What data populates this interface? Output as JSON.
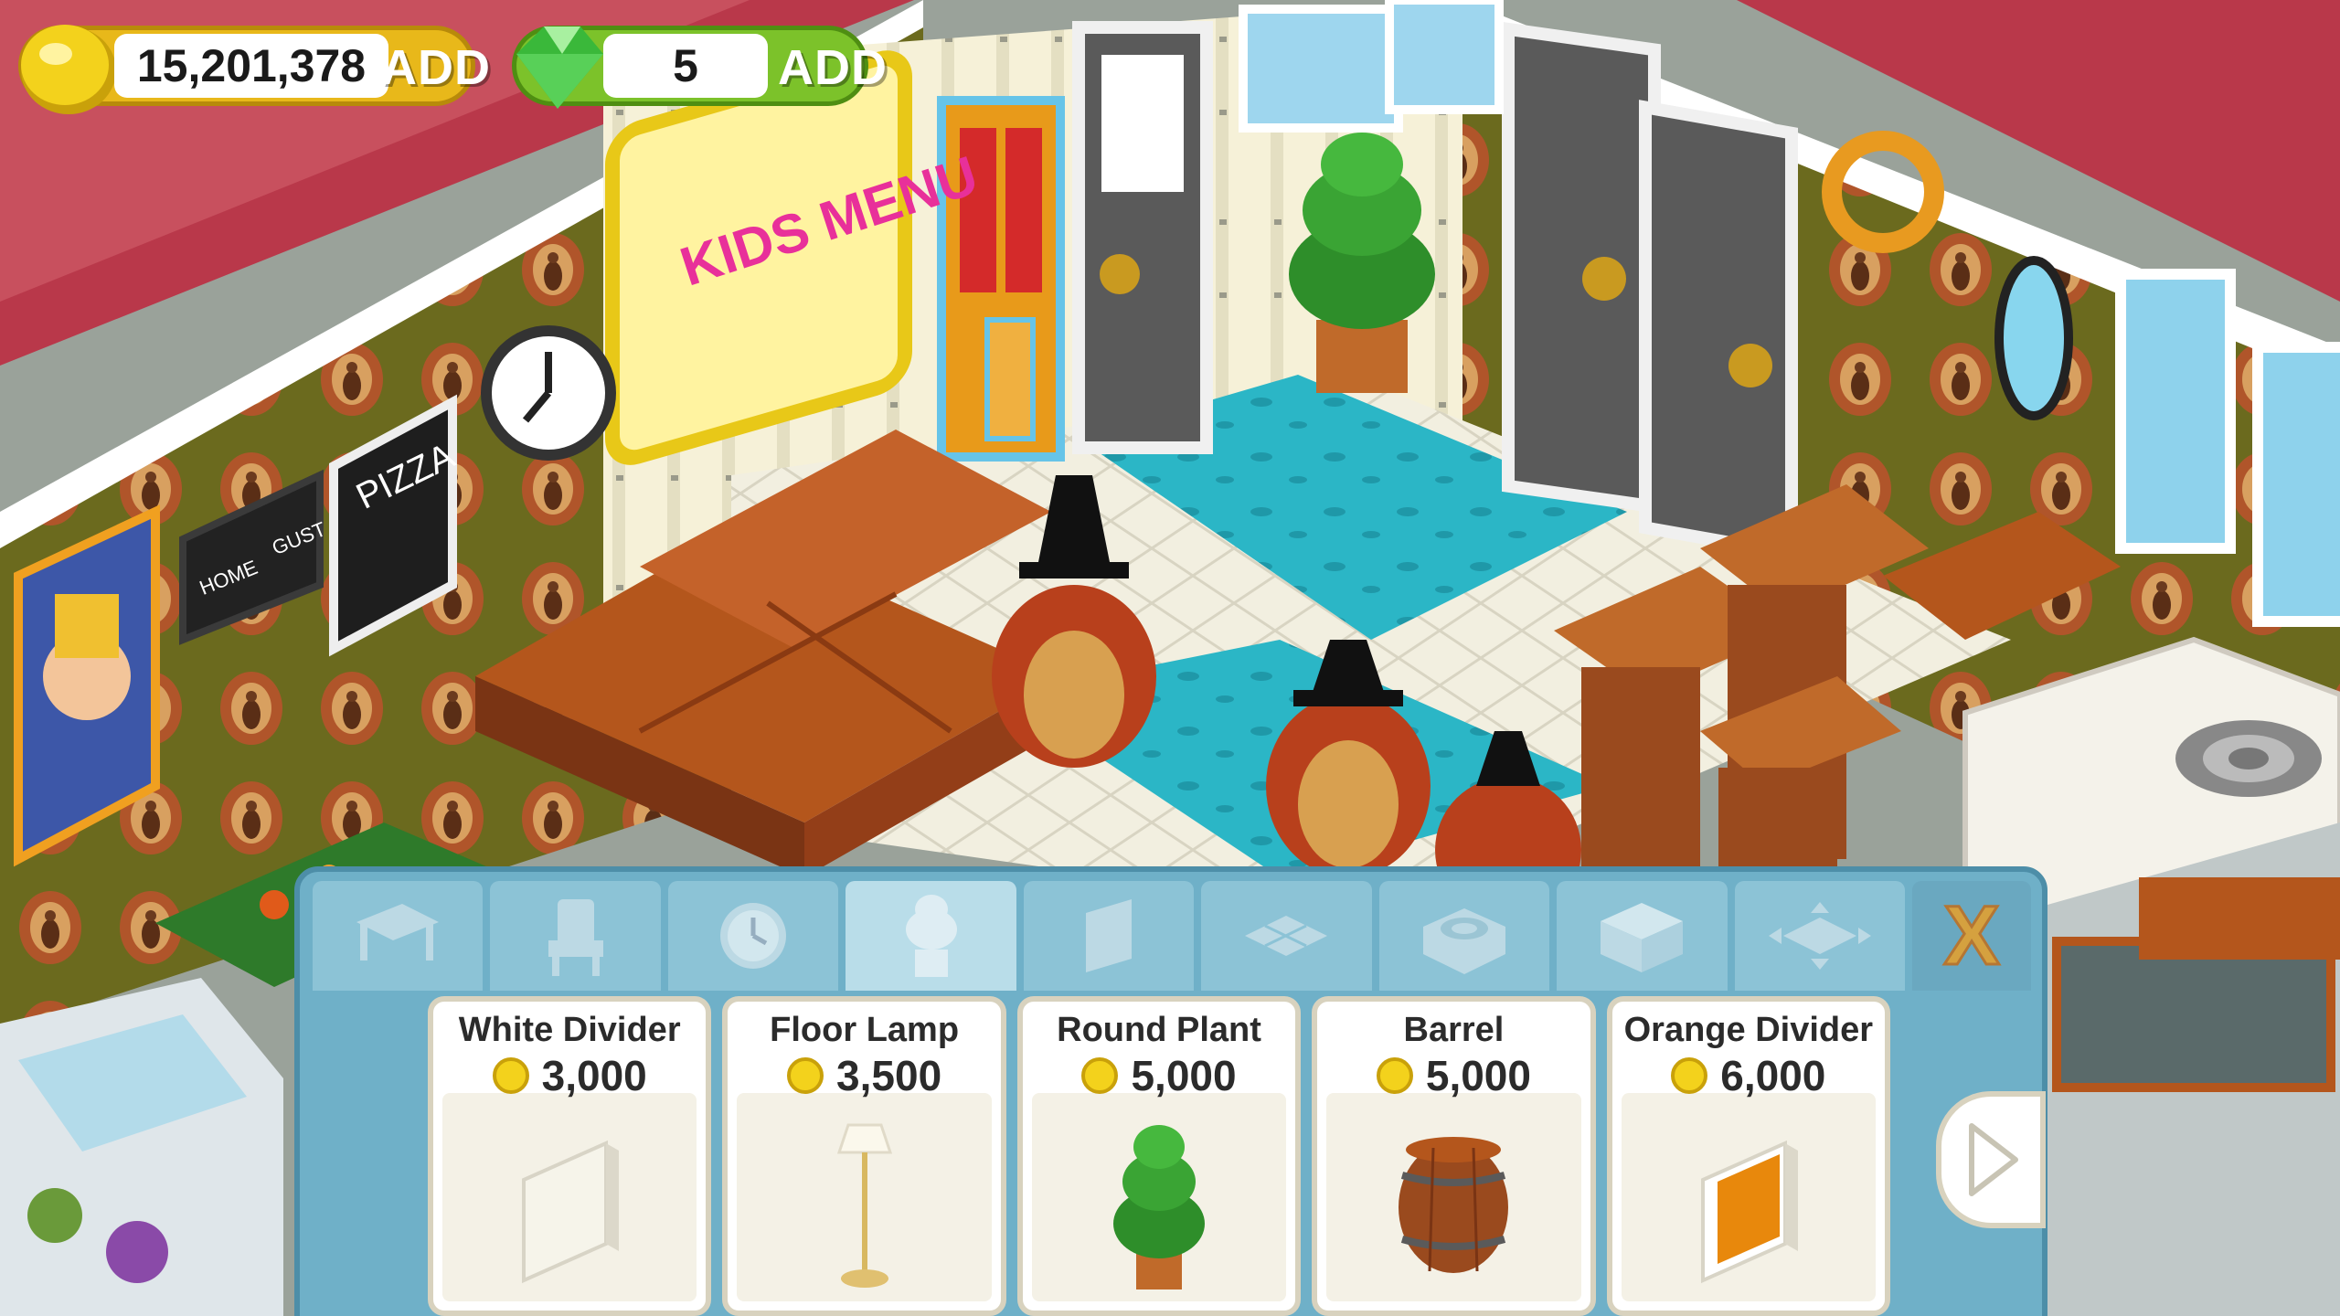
{
  "hud": {
    "coins": "15,201,378",
    "coins_add": "ADD",
    "gems": "5",
    "gems_add": "ADD"
  },
  "scene": {
    "wall_signs": {
      "kids_menu": "KIDS MENU",
      "pizza": "PIZZA",
      "scoreboard_home": "HOME",
      "scoreboard_guest": "GUST"
    }
  },
  "shop": {
    "tabs": [
      {
        "icon": "table-icon"
      },
      {
        "icon": "chair-icon"
      },
      {
        "icon": "clock-icon"
      },
      {
        "icon": "plant-icon",
        "active": true
      },
      {
        "icon": "wall-icon"
      },
      {
        "icon": "floor-icon"
      },
      {
        "icon": "stove-icon"
      },
      {
        "icon": "counter-icon"
      },
      {
        "icon": "expand-icon"
      },
      {
        "icon": "close-icon"
      }
    ],
    "close_label": "X",
    "items": [
      {
        "name": "White Divider",
        "price": "3,000"
      },
      {
        "name": "Floor Lamp",
        "price": "3,500"
      },
      {
        "name": "Round Plant",
        "price": "5,000"
      },
      {
        "name": "Barrel",
        "price": "5,000"
      },
      {
        "name": "Orange Divider",
        "price": "6,000"
      }
    ]
  },
  "colors": {
    "wallpaper": "#6b6a1e",
    "floor_teal": "#2bb6c6",
    "shop_panel": "#6fb0c8",
    "coin_gold": "#e8b81a",
    "gem_green": "#7cc22a"
  }
}
